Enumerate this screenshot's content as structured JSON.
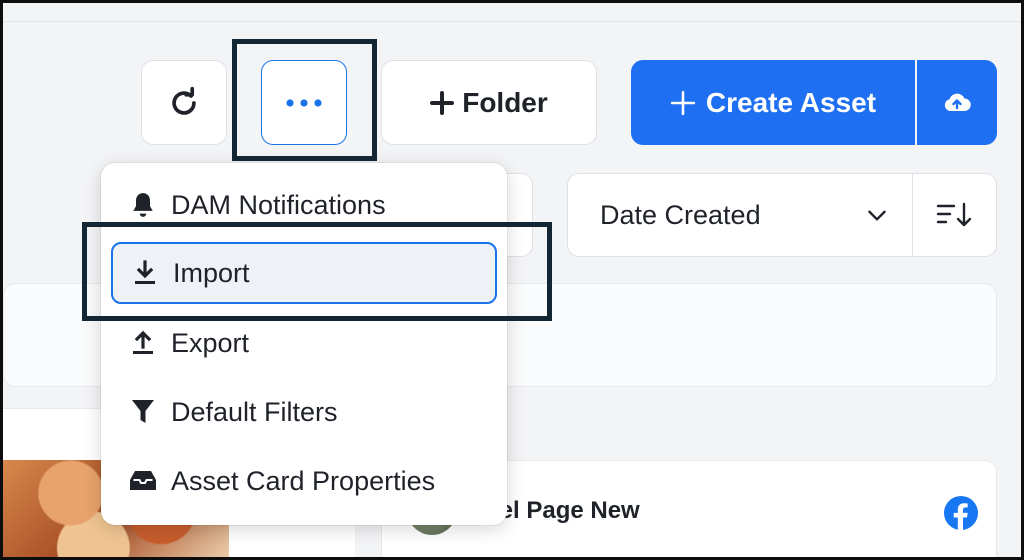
{
  "toolbar": {
    "refresh_icon": "refresh-icon",
    "more_icon": "more-horizontal-icon",
    "folder_label": "Folder",
    "create_asset_label": "Create Asset",
    "upload_icon": "cloud-upload-icon"
  },
  "sort": {
    "selected": "Date Created",
    "direction_icon": "sort-descending-icon"
  },
  "menu": {
    "items": [
      {
        "label": "DAM Notifications",
        "icon": "bell-icon"
      },
      {
        "label": "Import",
        "icon": "download-icon",
        "active": true
      },
      {
        "label": "Export",
        "icon": "upload-icon"
      },
      {
        "label": "Default Filters",
        "icon": "filter-icon"
      },
      {
        "label": "Asset Card Properties",
        "icon": "inbox-icon"
      }
    ]
  },
  "asset_card": {
    "title": "gel Page New",
    "source_icon": "facebook-icon"
  },
  "colors": {
    "accent": "#1f6ff2",
    "highlight_outline": "#132633",
    "focus_border": "#1a73e8"
  }
}
